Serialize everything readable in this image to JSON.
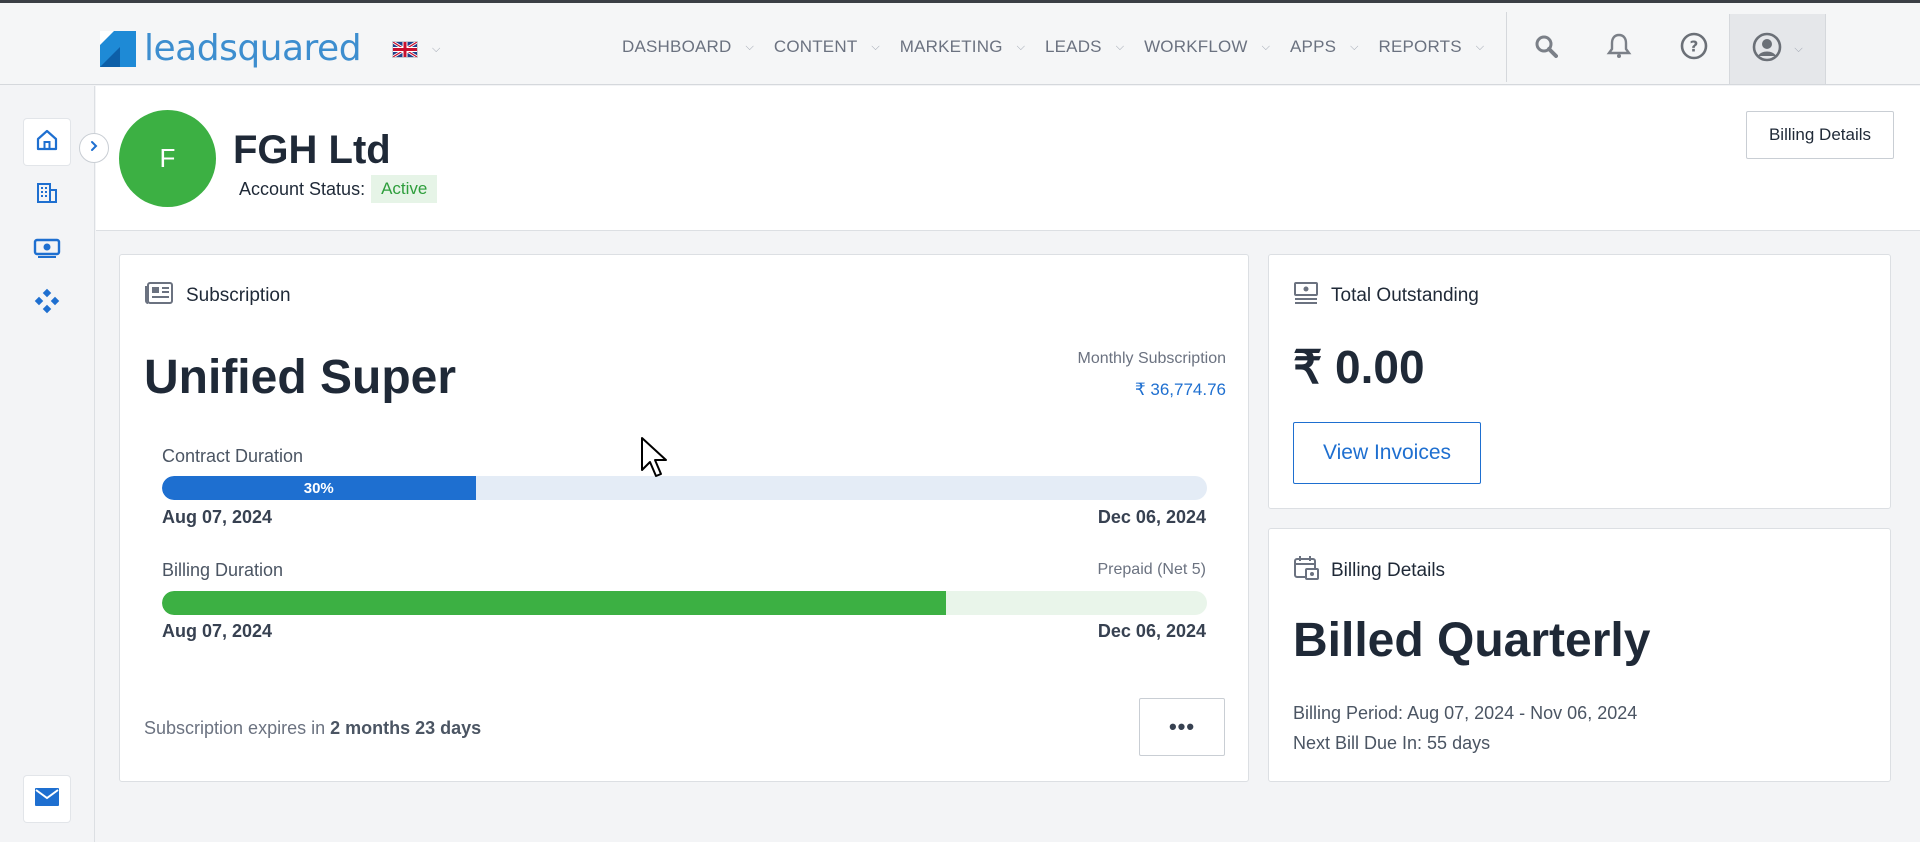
{
  "app": {
    "logo_text_light": "lead",
    "logo_text_bold": "squared",
    "language_flag": "uk-flag-icon"
  },
  "nav": {
    "items": [
      {
        "label": "DASHBOARD"
      },
      {
        "label": "CONTENT"
      },
      {
        "label": "MARKETING"
      },
      {
        "label": "LEADS"
      },
      {
        "label": "WORKFLOW"
      },
      {
        "label": "APPS"
      },
      {
        "label": "REPORTS"
      }
    ],
    "icons": [
      "search-icon",
      "bell-icon",
      "help-icon",
      "user-icon"
    ]
  },
  "account": {
    "avatar_letter": "F",
    "name": "FGH Ltd",
    "status_label": "Account Status:",
    "status": "Active",
    "billing_details_button": "Billing Details"
  },
  "subscription": {
    "title": "Subscription",
    "plan": "Unified Super",
    "monthly_label": "Monthly Subscription",
    "monthly_value": "₹ 36,774.76",
    "contract": {
      "label": "Contract Duration",
      "progress_percent": 30,
      "progress_label": "30%",
      "start": "Aug 07, 2024",
      "end": "Dec 06, 2024"
    },
    "billing": {
      "label": "Billing Duration",
      "terms": "Prepaid (Net 5)",
      "progress_percent": 75,
      "start": "Aug 07, 2024",
      "end": "Dec 06, 2024"
    },
    "expires_prefix": "Subscription expires in ",
    "expires_value": "2 months 23 days",
    "more_button": "•••"
  },
  "outstanding": {
    "title": "Total Outstanding",
    "amount": "₹ 0.00",
    "view_invoices": "View Invoices"
  },
  "billing_details": {
    "title": "Billing Details",
    "cycle": "Billed Quarterly",
    "period": "Billing Period: Aug 07, 2024 - Nov 06, 2024",
    "next_due": "Next Bill Due In: 55 days"
  },
  "colors": {
    "brand_blue": "#1e6fd0",
    "green": "#3cb043",
    "contract_track": "#e4ecf6",
    "billing_track": "#e9f5ea"
  }
}
